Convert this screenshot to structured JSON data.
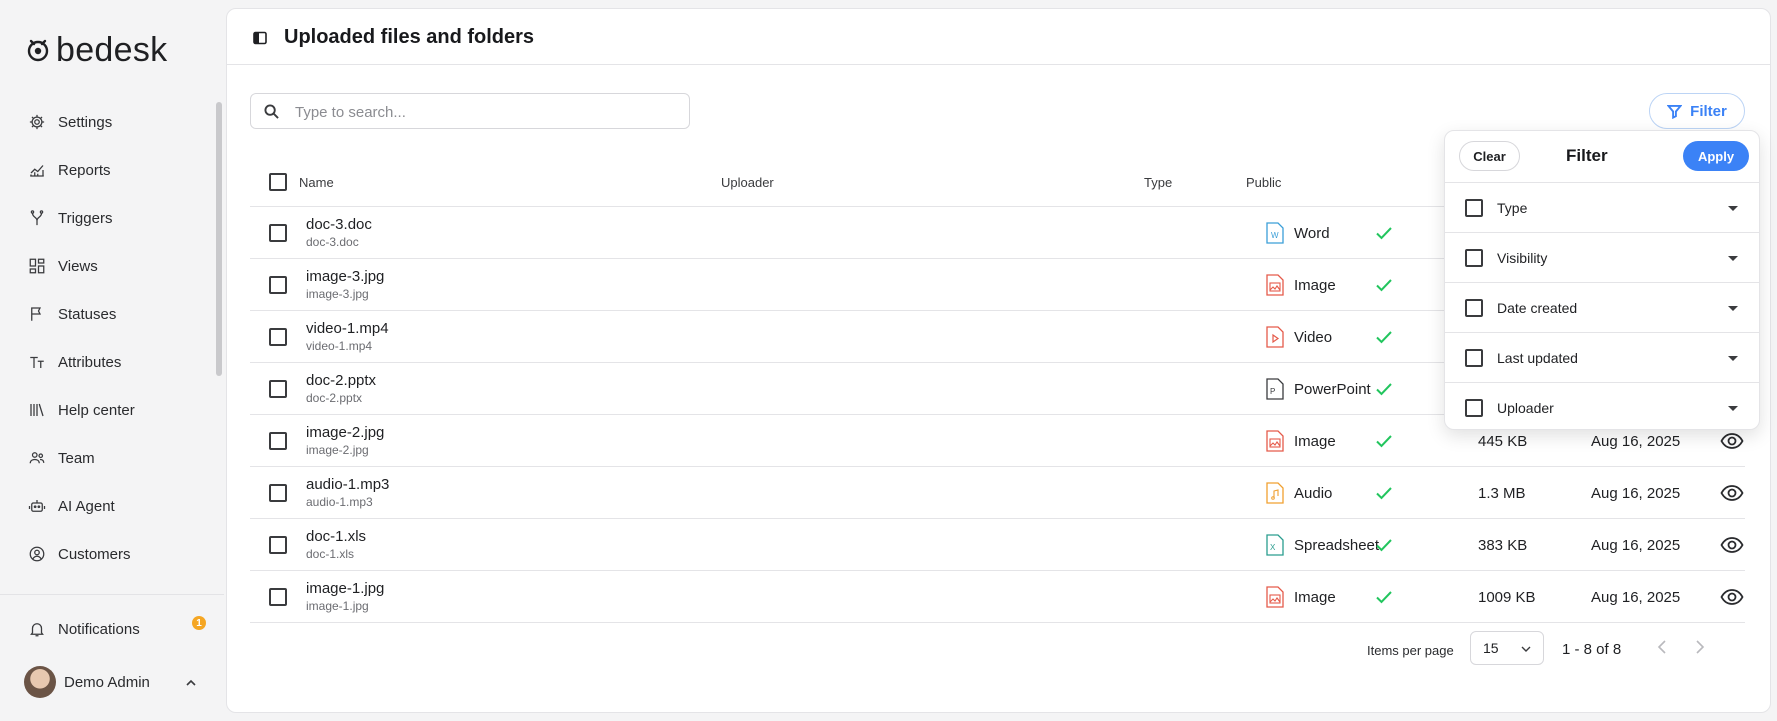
{
  "app": {
    "logo_text": "bedesk"
  },
  "sidebar": {
    "items": [
      {
        "label": "Settings",
        "icon": "gear-icon"
      },
      {
        "label": "Reports",
        "icon": "chart-line-icon"
      },
      {
        "label": "Triggers",
        "icon": "branch-icon"
      },
      {
        "label": "Views",
        "icon": "dashboard-icon"
      },
      {
        "label": "Statuses",
        "icon": "flag-icon"
      },
      {
        "label": "Attributes",
        "icon": "text-size-icon"
      },
      {
        "label": "Help center",
        "icon": "library-icon"
      },
      {
        "label": "Team",
        "icon": "team-icon"
      },
      {
        "label": "AI Agent",
        "icon": "robot-icon"
      },
      {
        "label": "Customers",
        "icon": "user-circle-icon"
      }
    ],
    "notifications": {
      "label": "Notifications",
      "count": "1"
    },
    "user": {
      "name": "Demo Admin"
    }
  },
  "page": {
    "title": "Uploaded files and folders"
  },
  "search": {
    "placeholder": "Type to search...",
    "value": ""
  },
  "filter_button": {
    "label": "Filter"
  },
  "table": {
    "headers": {
      "name": "Name",
      "uploader": "Uploader",
      "type": "Type",
      "public": "Public"
    },
    "rows": [
      {
        "name": "doc-3.doc",
        "sub": "doc-3.doc",
        "type": "Word",
        "icon": "word-file-icon",
        "public": true,
        "size": "",
        "date": ""
      },
      {
        "name": "image-3.jpg",
        "sub": "image-3.jpg",
        "type": "Image",
        "icon": "image-file-icon",
        "public": true,
        "size": "",
        "date": ""
      },
      {
        "name": "video-1.mp4",
        "sub": "video-1.mp4",
        "type": "Video",
        "icon": "video-file-icon",
        "public": true,
        "size": "",
        "date": ""
      },
      {
        "name": "doc-2.pptx",
        "sub": "doc-2.pptx",
        "type": "PowerPoint",
        "icon": "powerpoint-file-icon",
        "public": true,
        "size": "",
        "date": ""
      },
      {
        "name": "image-2.jpg",
        "sub": "image-2.jpg",
        "type": "Image",
        "icon": "image-file-icon",
        "public": true,
        "size": "445 KB",
        "date": "Aug 16, 2025"
      },
      {
        "name": "audio-1.mp3",
        "sub": "audio-1.mp3",
        "type": "Audio",
        "icon": "audio-file-icon",
        "public": true,
        "size": "1.3 MB",
        "date": "Aug 16, 2025"
      },
      {
        "name": "doc-1.xls",
        "sub": "doc-1.xls",
        "type": "Spreadsheet",
        "icon": "spreadsheet-file-icon",
        "public": true,
        "size": "383 KB",
        "date": "Aug 16, 2025"
      },
      {
        "name": "image-1.jpg",
        "sub": "image-1.jpg",
        "type": "Image",
        "icon": "image-file-icon",
        "public": true,
        "size": "1009 KB",
        "date": "Aug 16, 2025"
      }
    ]
  },
  "pagination": {
    "items_per_page_label": "Items per page",
    "items_per_page": "15",
    "range": "1 - 8 of 8"
  },
  "filter_popover": {
    "title": "Filter",
    "clear_label": "Clear",
    "apply_label": "Apply",
    "options": [
      "Type",
      "Visibility",
      "Date created",
      "Last updated",
      "Uploader"
    ]
  },
  "colors": {
    "accent": "#3b82f6",
    "check": "#22c55e",
    "badge": "#f5a623",
    "word": "#3b9fd8",
    "image": "#e55a4a",
    "video": "#e55a4a",
    "powerpoint": "#3a3b3e",
    "audio": "#f0a030",
    "spreadsheet": "#2a9d8f"
  }
}
